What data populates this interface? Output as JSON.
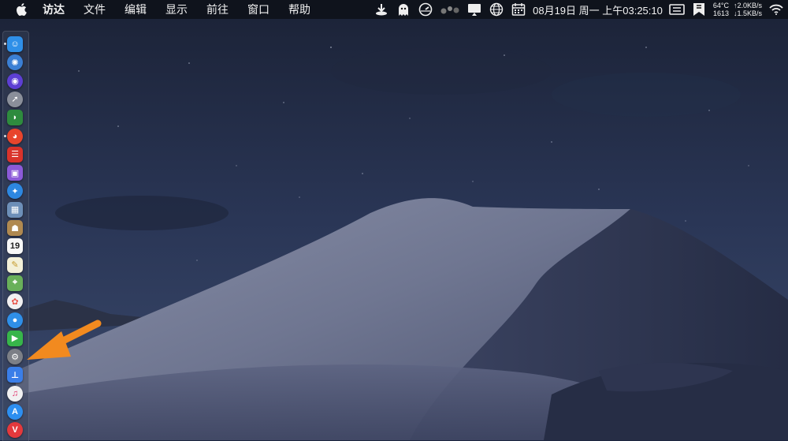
{
  "menubar": {
    "app_name": "访达",
    "menus": [
      "文件",
      "编辑",
      "显示",
      "前往",
      "窗口",
      "帮助"
    ],
    "clock": "08月19日 周一 上午03:25:10",
    "stats": {
      "temp": "64°C",
      "upload": "↑2.0KB/s",
      "fan": "1613",
      "download": "↓1.5KB/s"
    },
    "status_icons": [
      "download-icon",
      "ghost-icon",
      "speedometer-icon",
      "dots-icon",
      "display-icon",
      "globe-icon",
      "calendar-icon",
      "input-method-icon",
      "app-icon",
      "wifi-icon"
    ]
  },
  "dock": {
    "items": [
      {
        "name": "finder-icon",
        "bg": "#2f8fe8",
        "glyph": "☺",
        "running": true
      },
      {
        "name": "compass-icon",
        "bg": "#3b7fd4",
        "glyph": "✺",
        "running": false
      },
      {
        "name": "siri-icon",
        "bg": "#5d3fd3",
        "glyph": "◉",
        "running": false
      },
      {
        "name": "launchpad-icon",
        "bg": "#8a8f9a",
        "glyph": "➚",
        "running": false
      },
      {
        "name": "android-icon",
        "bg": "#2e8b3e",
        "glyph": "◗",
        "running": false
      },
      {
        "name": "color-wheel-icon",
        "bg": "#e8452c",
        "glyph": "◕",
        "running": true
      },
      {
        "name": "red-app-icon",
        "bg": "#d9332b",
        "glyph": "☰",
        "running": false
      },
      {
        "name": "purple-app-icon",
        "bg": "#8c5ad8",
        "glyph": "▣",
        "running": false
      },
      {
        "name": "safari-icon",
        "bg": "#2d87e0",
        "glyph": "✦",
        "running": false
      },
      {
        "name": "preview-icon",
        "bg": "#6d8fb8",
        "glyph": "▦",
        "running": false
      },
      {
        "name": "contacts-icon",
        "bg": "#b08950",
        "glyph": "☗",
        "running": false
      },
      {
        "name": "calendar-icon",
        "bg": "#f7f7f7",
        "glyph": "19",
        "running": false
      },
      {
        "name": "notes-icon",
        "bg": "#f3f0d8",
        "glyph": "✎",
        "running": false
      },
      {
        "name": "maps-icon",
        "bg": "#69b05a",
        "glyph": "⌖",
        "running": false
      },
      {
        "name": "photos-icon",
        "bg": "#f1f1f1",
        "glyph": "✿",
        "running": false
      },
      {
        "name": "messages-icon",
        "bg": "#2f8fe8",
        "glyph": "●",
        "running": false
      },
      {
        "name": "facetime-icon",
        "bg": "#37b54a",
        "glyph": "▶",
        "running": false
      },
      {
        "name": "system-preferences-icon",
        "bg": "#7c7f86",
        "glyph": "⚙",
        "running": false
      },
      {
        "name": "keynote-icon",
        "bg": "#3a7ee8",
        "glyph": "⊥",
        "running": false
      },
      {
        "name": "music-icon",
        "bg": "#f1f1f1",
        "glyph": "♫",
        "running": false
      },
      {
        "name": "app-store-icon",
        "bg": "#2d8ff0",
        "glyph": "A",
        "running": false
      },
      {
        "name": "vivaldi-icon",
        "bg": "#e4393c",
        "glyph": "V",
        "running": false
      }
    ]
  },
  "annotation": {
    "color": "#f28a1f"
  }
}
